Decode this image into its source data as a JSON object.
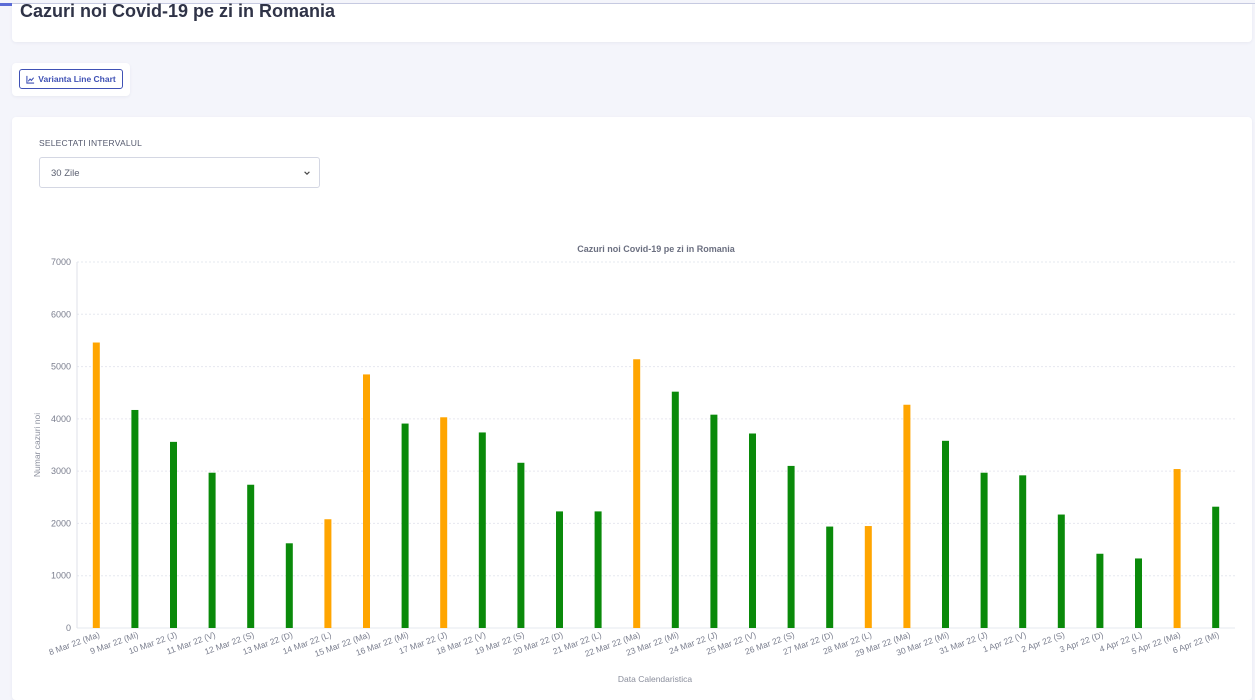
{
  "page": {
    "title": "Cazuri noi Covid-19 pe zi in Romania"
  },
  "toolbar": {
    "line_chart_button": "Varianta Line Chart"
  },
  "interval": {
    "label": "SELECTATI INTERVALUL",
    "selected": "30 Zile"
  },
  "colors": {
    "green": "#0a8a0a",
    "orange": "#ffa500",
    "accent": "#3f51b5"
  },
  "chart_data": {
    "type": "bar",
    "title": "Cazuri noi Covid-19 pe zi in Romania",
    "xlabel": "Data Calendaristica",
    "ylabel": "Numar cazuri noi",
    "ylim": [
      0,
      7000
    ],
    "yticks": [
      0,
      1000,
      2000,
      3000,
      4000,
      5000,
      6000,
      7000
    ],
    "grid": true,
    "categories": [
      "8 Mar 22 (Ma)",
      "9 Mar 22 (Mi)",
      "10 Mar 22 (J)",
      "11 Mar 22 (V)",
      "12 Mar 22 (S)",
      "13 Mar 22 (D)",
      "14 Mar 22 (L)",
      "15 Mar 22 (Ma)",
      "16 Mar 22 (Mi)",
      "17 Mar 22 (J)",
      "18 Mar 22 (V)",
      "19 Mar 22 (S)",
      "20 Mar 22 (D)",
      "21 Mar 22 (L)",
      "22 Mar 22 (Ma)",
      "23 Mar 22 (Mi)",
      "24 Mar 22 (J)",
      "25 Mar 22 (V)",
      "26 Mar 22 (S)",
      "27 Mar 22 (D)",
      "28 Mar 22 (L)",
      "29 Mar 22 (Ma)",
      "30 Mar 22 (Mi)",
      "31 Mar 22 (J)",
      "1 Apr 22 (V)",
      "2 Apr 22 (S)",
      "3 Apr 22 (D)",
      "4 Apr 22 (L)",
      "5 Apr 22 (Ma)",
      "6 Apr 22 (Mi)"
    ],
    "values": [
      5460,
      4170,
      3560,
      2970,
      2740,
      1620,
      2080,
      4850,
      3910,
      4030,
      3740,
      3160,
      2230,
      2230,
      5140,
      4520,
      4080,
      3720,
      3100,
      1940,
      1950,
      4270,
      3580,
      2970,
      2920,
      2170,
      1420,
      1330,
      3040,
      2320
    ],
    "bar_colors": [
      "orange",
      "green",
      "green",
      "green",
      "green",
      "green",
      "orange",
      "orange",
      "green",
      "orange",
      "green",
      "green",
      "green",
      "green",
      "orange",
      "green",
      "green",
      "green",
      "green",
      "green",
      "orange",
      "orange",
      "green",
      "green",
      "green",
      "green",
      "green",
      "green",
      "orange",
      "green"
    ]
  }
}
